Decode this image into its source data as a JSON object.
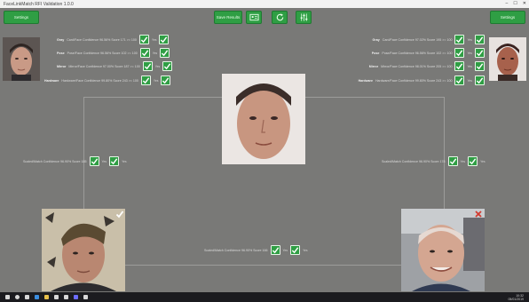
{
  "window": {
    "title": "FaceLinkMatch RFI Validation 1.0.0",
    "controls": [
      "–",
      "☐",
      "✕"
    ]
  },
  "toolbar": {
    "left_button": "Settings",
    "right_button": "Settings",
    "center_button": "Save Results"
  },
  "top_left": {
    "rows": [
      {
        "label": "Gray",
        "detail": "Card/Face Confidence 96.56%   Score 171 >= 100",
        "check_a": "Yes",
        "check_b": "Yes"
      },
      {
        "label": "Pose",
        "detail": "Pose/Face Confidence 96.56%   Score 102 >= 100",
        "check_a": "Yes",
        "check_b": "Yes"
      },
      {
        "label": "Mirror",
        "detail": "Mirror/Face Confidence 97.00%   Score 187 >= 100",
        "check_a": "Yes",
        "check_b": "Yes"
      },
      {
        "label": "Hardware",
        "detail": "Hardware/Face Confidence 99.80%   Score 243 >= 100",
        "check_a": "Yes",
        "check_b": "Yes"
      }
    ]
  },
  "top_right": {
    "rows": [
      {
        "label": "Gray",
        "detail": "Card/Face Confidence 97.02%   Score 195 >= 100",
        "check_a": "Yes",
        "check_b": "Yes"
      },
      {
        "label": "Pose",
        "detail": "Pose/Face Confidence 96.56%   Score 102 >= 100",
        "check_a": "Yes",
        "check_b": "Yes"
      },
      {
        "label": "Mirror",
        "detail": "Mirror/Face Confidence 98.01%   Score 205 >= 100",
        "check_a": "Yes",
        "check_b": "Yes"
      },
      {
        "label": "Hardware",
        "detail": "Hardware/Face Confidence 99.80%   Score 243 >= 100",
        "check_a": "Yes",
        "check_b": "Yes"
      }
    ]
  },
  "middle_left": {
    "detail": "Scaled/Match Confidence 96.90%   Score 185",
    "check_a": "Yes",
    "check_b": "Yes"
  },
  "middle_right": {
    "detail": "Scaled/Match Confidence 96.90%   Score 178",
    "check_a": "Yes",
    "check_b": "Yes"
  },
  "bottom_center": {
    "detail": "Scaled/Match Confidence 96.90%   Score 166",
    "check_a": "Yes",
    "check_b": "Yes"
  },
  "taskbar": {
    "time": "10:32",
    "date": "05/01/2019"
  },
  "colors": {
    "accent_green": "#2f9e44",
    "background": "#797977",
    "reject_red": "#d23a2f"
  }
}
